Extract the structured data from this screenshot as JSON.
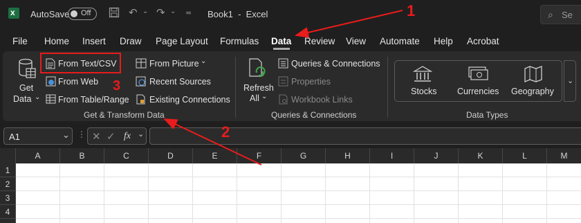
{
  "titlebar": {
    "autosave_label": "AutoSave",
    "autosave_state": "Off",
    "doc_title": "Book1  -  Excel",
    "search_placeholder": "Se",
    "icons": [
      "excel-logo-icon",
      "save-icon",
      "undo-icon",
      "redo-icon",
      "customize-quick-access-icon",
      "search-icon"
    ]
  },
  "menu": {
    "items": [
      "File",
      "Home",
      "Insert",
      "Draw",
      "Page Layout",
      "Formulas",
      "Data",
      "Review",
      "View",
      "Automate",
      "Help",
      "Acrobat"
    ],
    "active": "Data"
  },
  "ribbon": {
    "get_transform": {
      "get_data": "Get",
      "get_data_2": "Data",
      "from_text_csv": "From Text/CSV",
      "from_web": "From Web",
      "from_table_range": "From Table/Range",
      "from_picture": "From Picture",
      "recent_sources": "Recent Sources",
      "existing_connections": "Existing Connections",
      "group_label": "Get & Transform Data"
    },
    "queries": {
      "refresh": "Refresh",
      "refresh_all": "All",
      "queries_connections": "Queries & Connections",
      "properties": "Properties",
      "workbook_links": "Workbook Links",
      "group_label": "Queries & Connections"
    },
    "data_types": {
      "stocks": "Stocks",
      "currencies": "Currencies",
      "geography": "Geography",
      "group_label": "Data Types"
    }
  },
  "formula_bar": {
    "name_box": "A1",
    "fx": "fx",
    "formula": ""
  },
  "grid": {
    "columns": [
      "A",
      "B",
      "C",
      "D",
      "E",
      "F",
      "G",
      "H",
      "I",
      "J",
      "K",
      "L",
      "M"
    ],
    "rows": [
      "1",
      "2",
      "3",
      "4"
    ]
  },
  "annotations": {
    "step1": "1",
    "step2": "2",
    "step3": "3",
    "color": "#e81c1c"
  }
}
